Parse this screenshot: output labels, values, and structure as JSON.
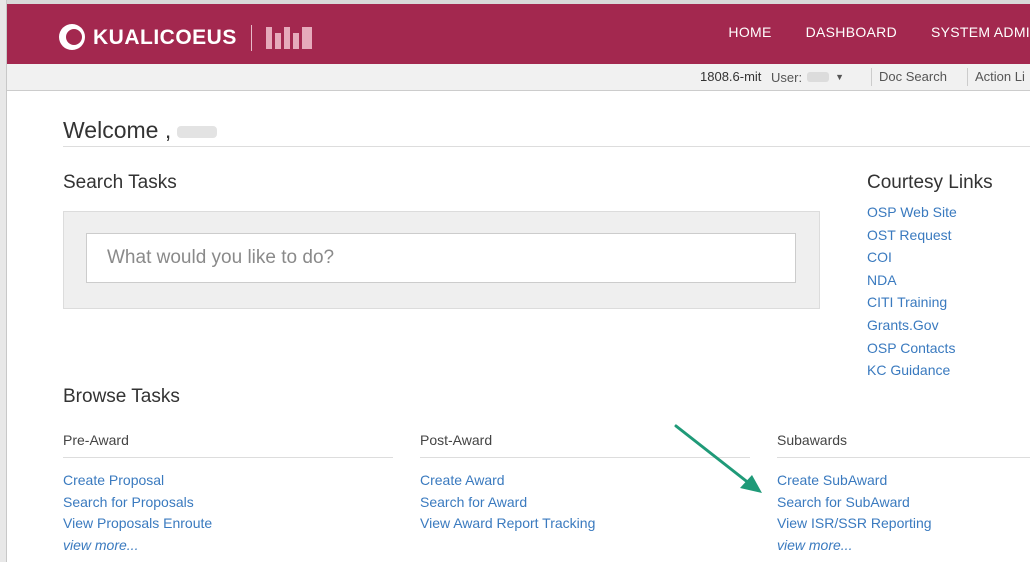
{
  "header": {
    "logo_text": "KUALICOEUS",
    "logo_mark": "KC",
    "nav": [
      "HOME",
      "DASHBOARD",
      "SYSTEM ADMI"
    ]
  },
  "subbar": {
    "version": "1808.6-mit",
    "user_label": "User:",
    "doc_search": "Doc Search",
    "action_list": "Action Li"
  },
  "welcome": "Welcome ,",
  "search": {
    "title": "Search Tasks",
    "placeholder": "What would you like to do?"
  },
  "courtesy": {
    "title": "Courtesy Links",
    "links": [
      "OSP Web Site",
      "OST Request",
      "COI",
      "NDA",
      "CITI Training",
      "Grants.Gov",
      "OSP Contacts",
      "KC Guidance"
    ]
  },
  "browse": {
    "title": "Browse Tasks",
    "columns": [
      {
        "header": "Pre-Award",
        "links": [
          "Create Proposal",
          "Search for Proposals",
          "View Proposals Enroute"
        ],
        "more": "view more..."
      },
      {
        "header": "Post-Award",
        "links": [
          "Create Award",
          "Search for Award",
          "View Award Report Tracking"
        ],
        "more": ""
      },
      {
        "header": "Subawards",
        "links": [
          "Create SubAward",
          "Search for SubAward",
          "View ISR/SSR Reporting"
        ],
        "more": "view more..."
      }
    ]
  },
  "colors": {
    "brand": "#a3284f",
    "link": "#3a7abf",
    "annotation_arrow": "#1f9a78"
  },
  "icons": {
    "logo": "kc-logo-icon",
    "mit_logo": "mit-logo-icon",
    "user_dropdown": "chevron-down-icon",
    "annotation": "green-arrow-icon"
  }
}
